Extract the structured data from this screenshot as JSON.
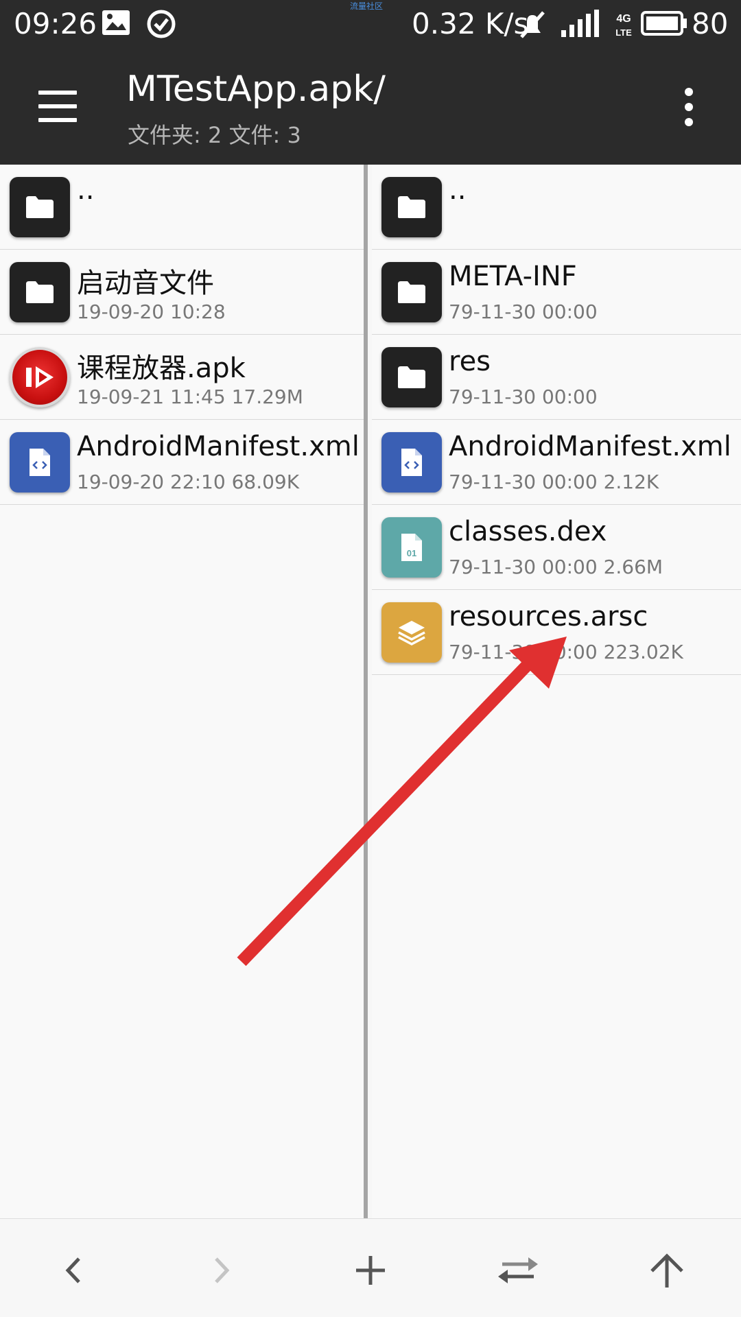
{
  "status_bar": {
    "time": "09:26",
    "net_speed": "0.32 K/s",
    "network_type": "4G LTE",
    "battery": "80",
    "watermark": "流量社区"
  },
  "app_bar": {
    "title": "MTestApp.apk/",
    "subtitle": "文件夹: 2  文件: 3"
  },
  "left_panel": {
    "parent": "..",
    "items": [
      {
        "name": "启动音文件",
        "meta": "19-09-20 10:28",
        "icon": "folder-icon"
      },
      {
        "name": "课程放器.apk",
        "meta": "19-09-21 11:45  17.29M",
        "icon": "apk-icon"
      },
      {
        "name": "AndroidManifest.xml",
        "meta": "19-09-20 22:10  68.09K",
        "icon": "xml-file-icon"
      }
    ]
  },
  "right_panel": {
    "parent": "..",
    "items": [
      {
        "name": "META-INF",
        "meta": "79-11-30 00:00",
        "icon": "folder-icon"
      },
      {
        "name": "res",
        "meta": "79-11-30 00:00",
        "icon": "folder-icon"
      },
      {
        "name": "AndroidManifest.xml",
        "meta": "79-11-30 00:00  2.12K",
        "icon": "xml-file-icon"
      },
      {
        "name": "classes.dex",
        "meta": "79-11-30 00:00  2.66M",
        "icon": "dex-file-icon"
      },
      {
        "name": "resources.arsc",
        "meta": "79-11-30 00:00  223.02K",
        "icon": "arsc-file-icon"
      }
    ]
  },
  "bottom_bar": {
    "buttons": [
      "back-icon",
      "forward-icon",
      "add-icon",
      "swap-icon",
      "up-icon"
    ]
  },
  "colors": {
    "bar_bg": "#2b2b2b",
    "folder": "#222222",
    "xml": "#3a5fb4",
    "dex": "#5ea8a8",
    "arsc": "#dca640",
    "arrow": "#e03030"
  }
}
